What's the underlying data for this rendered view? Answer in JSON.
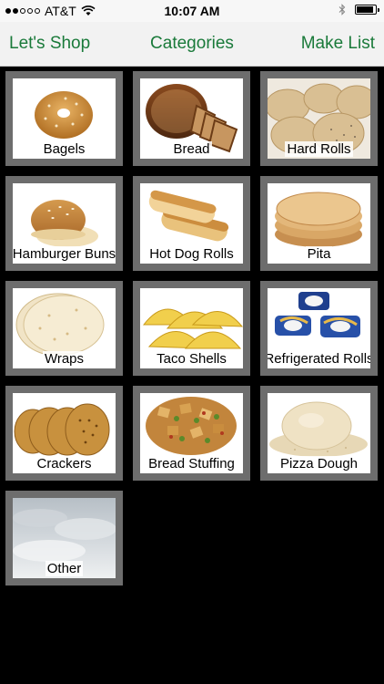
{
  "status": {
    "carrier": "AT&T",
    "time": "10:07 AM",
    "signal_bars": 2,
    "signal_total": 5,
    "battery_level": 0.9
  },
  "nav": {
    "left_label": "Let's Shop",
    "title": "Categories",
    "right_label": "Make List",
    "accent_color": "#1a7a3a"
  },
  "categories": [
    {
      "label": "Bagels",
      "icon": "bagel-icon"
    },
    {
      "label": "Bread",
      "icon": "bread-icon"
    },
    {
      "label": "Hard Rolls",
      "icon": "hard-rolls-icon"
    },
    {
      "label": "Hamburger Buns",
      "icon": "hamburger-bun-icon"
    },
    {
      "label": "Hot Dog Rolls",
      "icon": "hot-dog-roll-icon"
    },
    {
      "label": "Pita",
      "icon": "pita-icon"
    },
    {
      "label": "Wraps",
      "icon": "wraps-icon"
    },
    {
      "label": "Taco Shells",
      "icon": "taco-shells-icon"
    },
    {
      "label": "Refrigerated Rolls",
      "icon": "refrigerated-rolls-icon"
    },
    {
      "label": "Crackers",
      "icon": "crackers-icon"
    },
    {
      "label": "Bread Stuffing",
      "icon": "bread-stuffing-icon"
    },
    {
      "label": "Pizza Dough",
      "icon": "pizza-dough-icon"
    },
    {
      "label": "Other",
      "icon": "sky-icon"
    }
  ]
}
